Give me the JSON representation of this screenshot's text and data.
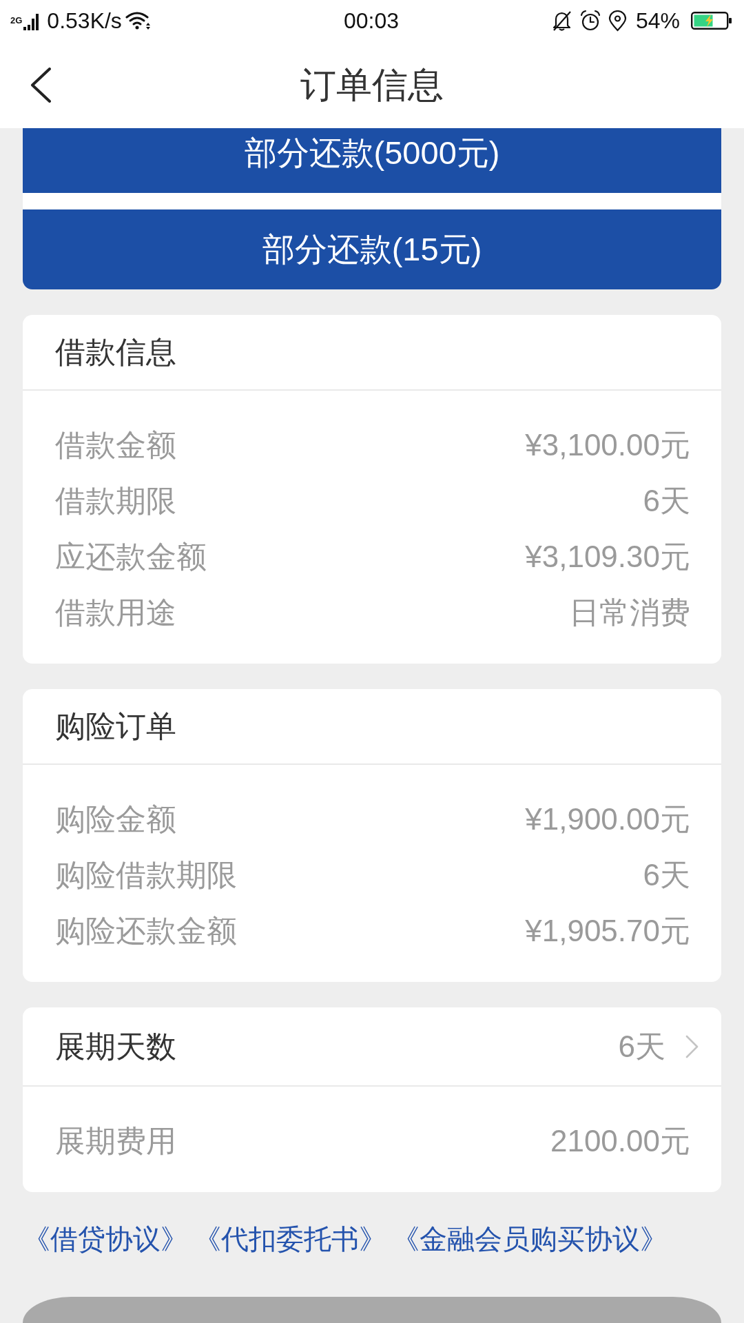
{
  "status_bar": {
    "network_type": "2G",
    "speed": "0.53K/s",
    "time": "00:03",
    "battery": "54%"
  },
  "header": {
    "title": "订单信息"
  },
  "action_buttons": [
    {
      "label": "部分还款(5000元)"
    },
    {
      "label": "部分还款(15元)"
    }
  ],
  "cards": [
    {
      "header": {
        "kind": "title",
        "label": "借款信息"
      },
      "rows": [
        {
          "label": "借款金额",
          "value": "¥3,100.00元"
        },
        {
          "label": "借款期限",
          "value": "6天"
        },
        {
          "label": "应还款金额",
          "value": "¥3,109.30元"
        },
        {
          "label": "借款用途",
          "value": "日常消费"
        }
      ]
    },
    {
      "header": {
        "kind": "title",
        "label": "购险订单"
      },
      "rows": [
        {
          "label": "购险金额",
          "value": "¥1,900.00元"
        },
        {
          "label": "购险借款期限",
          "value": "6天"
        },
        {
          "label": "购险还款金额",
          "value": "¥1,905.70元"
        }
      ]
    },
    {
      "header": {
        "kind": "picker",
        "label": "展期天数",
        "value": "6天"
      },
      "rows": [
        {
          "label": "展期费用",
          "value": "2100.00元"
        }
      ]
    }
  ],
  "agreements": [
    {
      "label": "《借贷协议》"
    },
    {
      "label": "《代扣委托书》"
    },
    {
      "label": "《金融会员购买协议》"
    }
  ],
  "footer_button": {
    "disabled": true
  }
}
